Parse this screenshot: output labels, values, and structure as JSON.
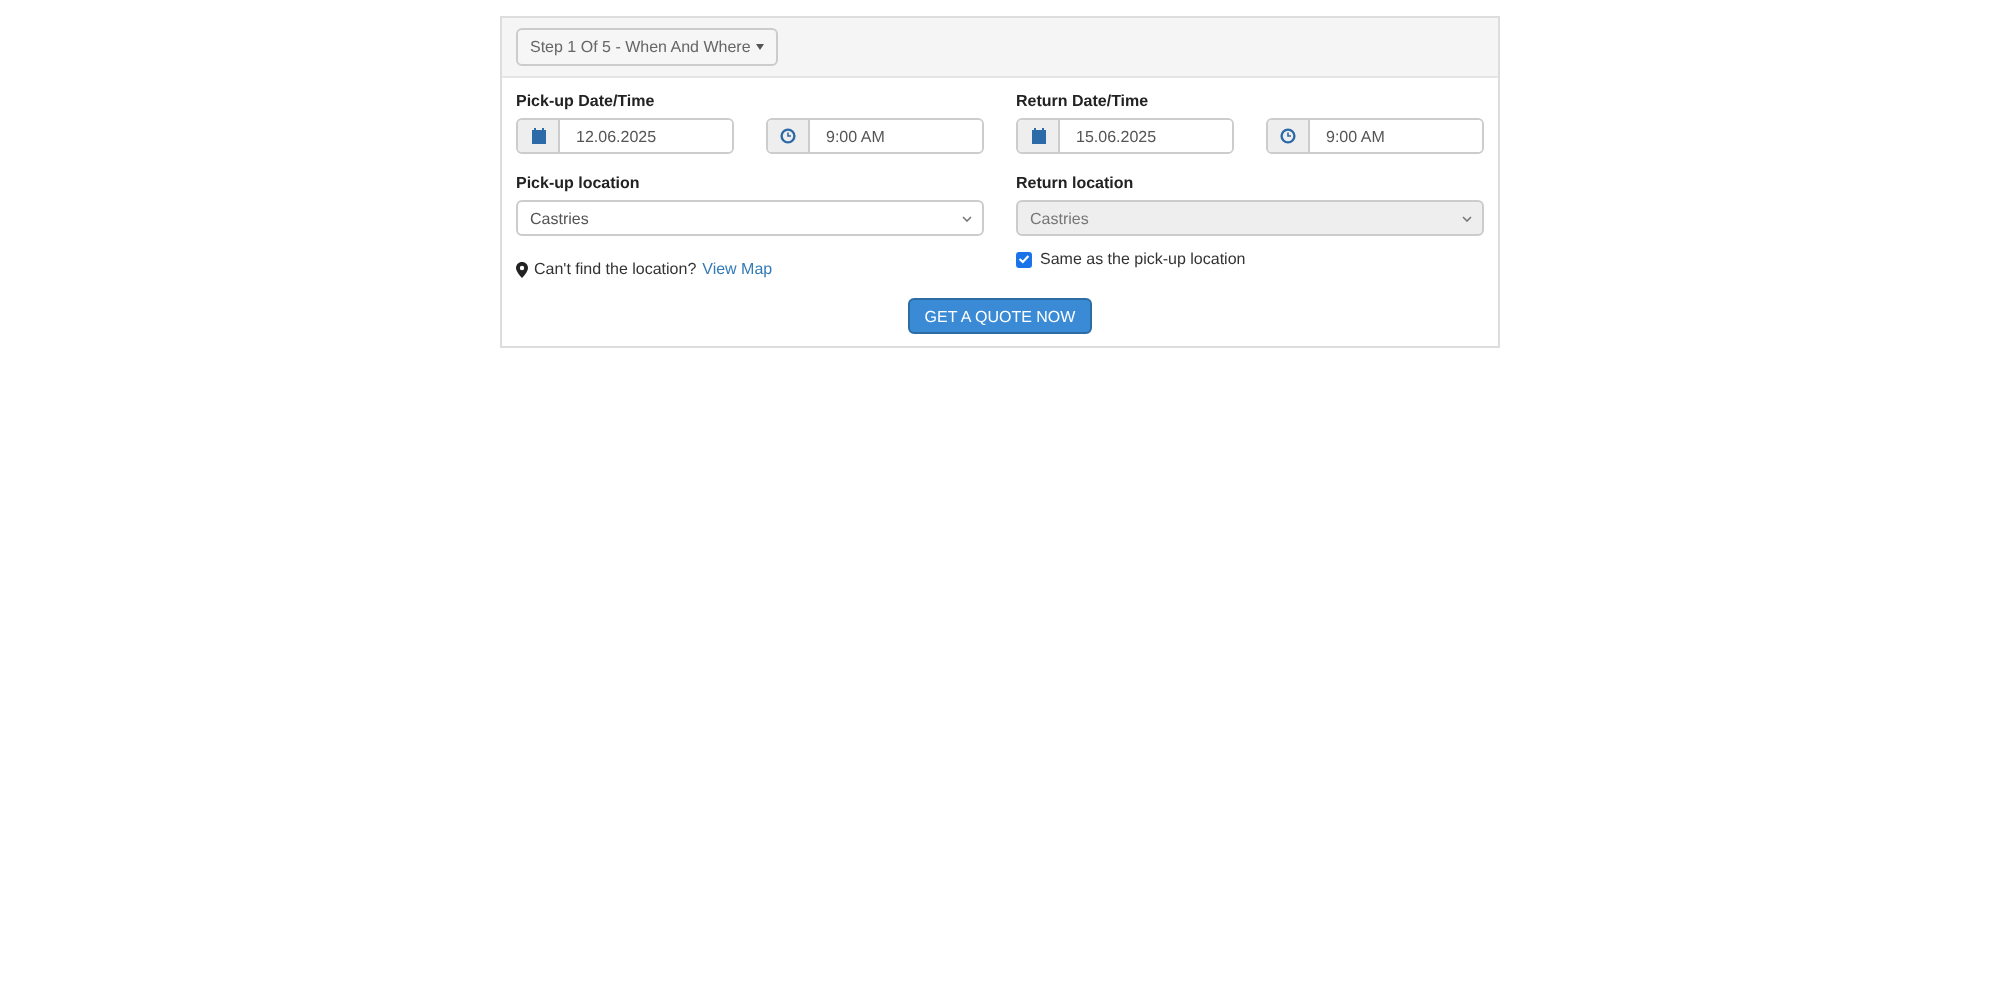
{
  "step_button": {
    "label": "Step 1 Of 5 - When And Where"
  },
  "columns": [
    {
      "datetime_label": "Pick-up Date/Time",
      "date": "12.06.2025",
      "time": "9:00 AM",
      "location_label": "Pick-up location",
      "location": "Castries",
      "location_disabled": false,
      "kind": "hint",
      "hint": "Can't find the location?",
      "link": "View Map"
    },
    {
      "datetime_label": "Return Date/Time",
      "date": "15.06.2025",
      "time": "9:00 AM",
      "location_label": "Return location",
      "location": "Castries",
      "location_disabled": true,
      "kind": "checkbox",
      "checkbox_label": "Same as the pick-up location",
      "checked": true
    }
  ],
  "submit": {
    "label": "GET A QUOTE NOW"
  }
}
